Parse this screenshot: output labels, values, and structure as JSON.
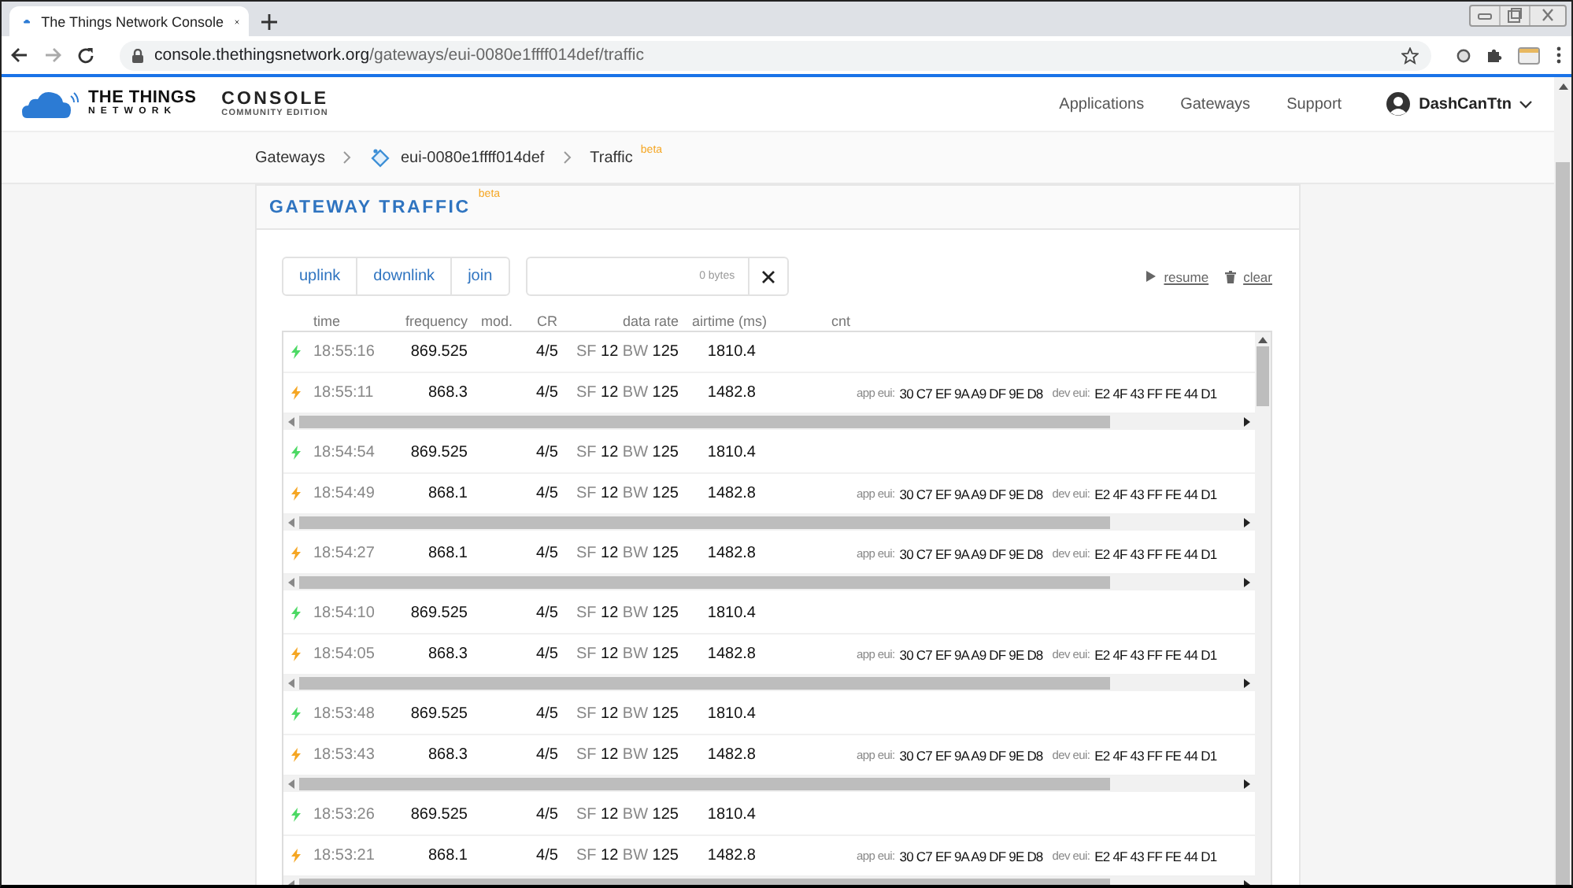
{
  "browser": {
    "tab_title": "The Things Network Console",
    "url": {
      "host": "console.thethingsnetwork.org",
      "path": "/gateways/eui-0080e1ffff014def/traffic"
    }
  },
  "header": {
    "logo_line1": "THE THINGS",
    "logo_line2": "NETWORK",
    "product": "CONSOLE",
    "edition": "COMMUNITY EDITION",
    "nav": [
      "Applications",
      "Gateways",
      "Support"
    ],
    "user": "DashCanTtn"
  },
  "breadcrumb": [
    {
      "label": "Gateways",
      "kind": "link"
    },
    {
      "label": "eui-0080e1ffff014def",
      "kind": "gateway"
    },
    {
      "label": "Traffic",
      "kind": "current",
      "badge": "beta"
    }
  ],
  "card": {
    "title": "GATEWAY TRAFFIC",
    "badge": "beta",
    "filters": [
      {
        "label": "uplink",
        "selected": false
      },
      {
        "label": "downlink",
        "selected": false
      },
      {
        "label": "join",
        "selected": false
      }
    ],
    "byte_count": "0 bytes",
    "resume": "resume",
    "clear": "clear",
    "columns": [
      "time",
      "frequency",
      "mod.",
      "CR",
      "data rate",
      "airtime (ms)",
      "cnt"
    ],
    "groups": [
      {
        "rows": [
          {
            "kind": "uplink",
            "time": "18:55:16",
            "frequency": "869.525",
            "cr": "4/5",
            "sf_label": "SF",
            "sf": "12",
            "bw_label": "BW",
            "bw": "125",
            "airtime": "1810.4"
          },
          {
            "kind": "join",
            "time": "18:55:11",
            "frequency": "868.3",
            "cr": "4/5",
            "sf_label": "SF",
            "sf": "12",
            "bw_label": "BW",
            "bw": "125",
            "airtime": "1482.8",
            "app_eui_label": "app eui:",
            "app_eui": "30 C7 EF 9A A9 DF 9E D8",
            "dev_eui_label": "dev eui:",
            "dev_eui": "E2 4F 43 FF FE 44 D1"
          }
        ]
      },
      {
        "rows": [
          {
            "kind": "uplink",
            "time": "18:54:54",
            "frequency": "869.525",
            "cr": "4/5",
            "sf_label": "SF",
            "sf": "12",
            "bw_label": "BW",
            "bw": "125",
            "airtime": "1810.4"
          },
          {
            "kind": "join",
            "time": "18:54:49",
            "frequency": "868.1",
            "cr": "4/5",
            "sf_label": "SF",
            "sf": "12",
            "bw_label": "BW",
            "bw": "125",
            "airtime": "1482.8",
            "app_eui_label": "app eui:",
            "app_eui": "30 C7 EF 9A A9 DF 9E D8",
            "dev_eui_label": "dev eui:",
            "dev_eui": "E2 4F 43 FF FE 44 D1"
          }
        ]
      },
      {
        "rows": [
          {
            "kind": "join",
            "time": "18:54:27",
            "frequency": "868.1",
            "cr": "4/5",
            "sf_label": "SF",
            "sf": "12",
            "bw_label": "BW",
            "bw": "125",
            "airtime": "1482.8",
            "app_eui_label": "app eui:",
            "app_eui": "30 C7 EF 9A A9 DF 9E D8",
            "dev_eui_label": "dev eui:",
            "dev_eui": "E2 4F 43 FF FE 44 D1"
          }
        ]
      },
      {
        "rows": [
          {
            "kind": "uplink",
            "time": "18:54:10",
            "frequency": "869.525",
            "cr": "4/5",
            "sf_label": "SF",
            "sf": "12",
            "bw_label": "BW",
            "bw": "125",
            "airtime": "1810.4"
          },
          {
            "kind": "join",
            "time": "18:54:05",
            "frequency": "868.3",
            "cr": "4/5",
            "sf_label": "SF",
            "sf": "12",
            "bw_label": "BW",
            "bw": "125",
            "airtime": "1482.8",
            "app_eui_label": "app eui:",
            "app_eui": "30 C7 EF 9A A9 DF 9E D8",
            "dev_eui_label": "dev eui:",
            "dev_eui": "E2 4F 43 FF FE 44 D1"
          }
        ]
      },
      {
        "rows": [
          {
            "kind": "uplink",
            "time": "18:53:48",
            "frequency": "869.525",
            "cr": "4/5",
            "sf_label": "SF",
            "sf": "12",
            "bw_label": "BW",
            "bw": "125",
            "airtime": "1810.4"
          },
          {
            "kind": "join",
            "time": "18:53:43",
            "frequency": "868.3",
            "cr": "4/5",
            "sf_label": "SF",
            "sf": "12",
            "bw_label": "BW",
            "bw": "125",
            "airtime": "1482.8",
            "app_eui_label": "app eui:",
            "app_eui": "30 C7 EF 9A A9 DF 9E D8",
            "dev_eui_label": "dev eui:",
            "dev_eui": "E2 4F 43 FF FE 44 D1"
          }
        ]
      },
      {
        "rows": [
          {
            "kind": "uplink",
            "time": "18:53:26",
            "frequency": "869.525",
            "cr": "4/5",
            "sf_label": "SF",
            "sf": "12",
            "bw_label": "BW",
            "bw": "125",
            "airtime": "1810.4"
          },
          {
            "kind": "join",
            "time": "18:53:21",
            "frequency": "868.1",
            "cr": "4/5",
            "sf_label": "SF",
            "sf": "12",
            "bw_label": "BW",
            "bw": "125",
            "airtime": "1482.8",
            "app_eui_label": "app eui:",
            "app_eui": "30 C7 EF 9A A9 DF 9E D8",
            "dev_eui_label": "dev eui:",
            "dev_eui": "E2 4F 43 FF FE 44 D1"
          }
        ]
      }
    ]
  }
}
